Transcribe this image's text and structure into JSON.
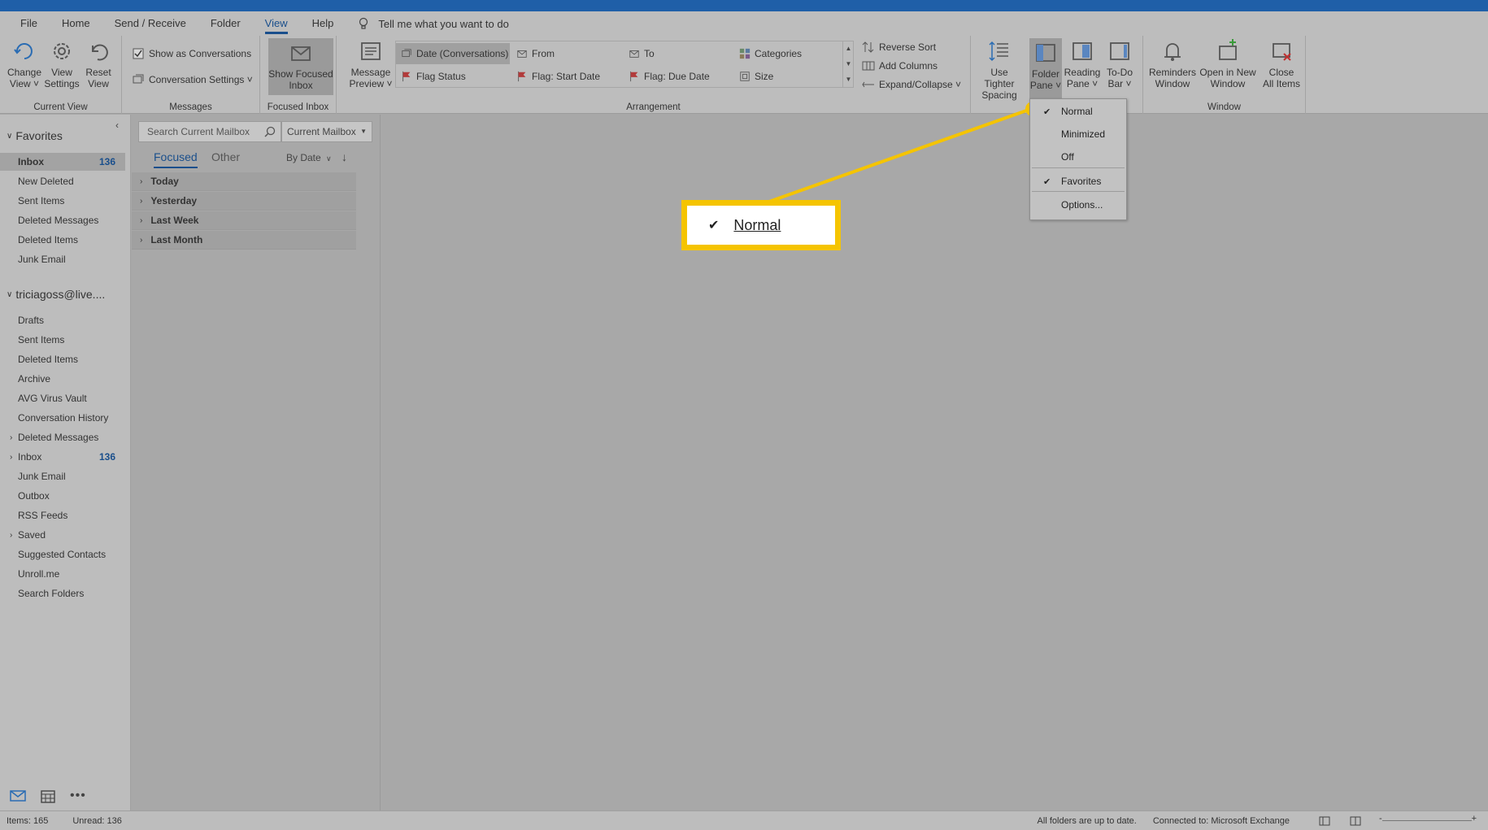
{
  "menu": {
    "tabs": [
      "File",
      "Home",
      "Send / Receive",
      "Folder",
      "View",
      "Help"
    ],
    "active_tab": "View",
    "tell_me": "Tell me what you want to do"
  },
  "ribbon": {
    "current_view": {
      "label": "Current View",
      "change_view": [
        "Change",
        "View ˅"
      ],
      "view_settings": [
        "View",
        "Settings"
      ],
      "reset_view": [
        "Reset",
        "View"
      ]
    },
    "messages": {
      "label": "Messages",
      "show_as_conversations": "Show as Conversations",
      "conversation_settings": "Conversation Settings ˅"
    },
    "focused_inbox": {
      "label": "Focused Inbox",
      "show_focused": [
        "Show Focused",
        "Inbox"
      ]
    },
    "arrangement": {
      "label": "Arrangement",
      "message_preview": [
        "Message",
        "Preview ˅"
      ],
      "items": [
        "Date (Conversations)",
        "From",
        "To",
        "Categories",
        "Flag Status",
        "Flag: Start Date",
        "Flag: Due Date",
        "Size"
      ],
      "reverse_sort": "Reverse Sort",
      "add_columns": "Add Columns",
      "expand_collapse": "Expand/Collapse ˅"
    },
    "layout": {
      "tighter_spacing": [
        "Use Tighter",
        "Spacing"
      ],
      "folder_pane": [
        "Folder",
        "Pane ˅"
      ],
      "reading_pane": [
        "Reading",
        "Pane ˅"
      ],
      "todo_bar": [
        "To-Do",
        "Bar ˅"
      ]
    },
    "window": {
      "label": "Window",
      "reminders": [
        "Reminders",
        "Window"
      ],
      "open_new": [
        "Open in New",
        "Window"
      ],
      "close_all": [
        "Close",
        "All Items"
      ]
    }
  },
  "nav": {
    "favorites_header": "Favorites",
    "favorites": [
      {
        "label": "Inbox",
        "count": "136"
      },
      {
        "label": "New Deleted",
        "count": ""
      },
      {
        "label": "Sent Items",
        "count": ""
      },
      {
        "label": "Deleted Messages",
        "count": ""
      },
      {
        "label": "Deleted Items",
        "count": ""
      },
      {
        "label": "Junk Email",
        "count": ""
      }
    ],
    "account_header": "triciagoss@live....",
    "account_folders": [
      {
        "label": "Drafts",
        "count": "",
        "expandable": false
      },
      {
        "label": "Sent Items",
        "count": "",
        "expandable": false
      },
      {
        "label": "Deleted Items",
        "count": "",
        "expandable": false
      },
      {
        "label": "Archive",
        "count": "",
        "expandable": false
      },
      {
        "label": "AVG Virus Vault",
        "count": "",
        "expandable": false
      },
      {
        "label": "Conversation History",
        "count": "",
        "expandable": false
      },
      {
        "label": "Deleted Messages",
        "count": "",
        "expandable": true
      },
      {
        "label": "Inbox",
        "count": "136",
        "expandable": true
      },
      {
        "label": "Junk Email",
        "count": "",
        "expandable": false
      },
      {
        "label": "Outbox",
        "count": "",
        "expandable": false
      },
      {
        "label": "RSS Feeds",
        "count": "",
        "expandable": false
      },
      {
        "label": "Saved",
        "count": "",
        "expandable": true
      },
      {
        "label": "Suggested Contacts",
        "count": "",
        "expandable": false
      },
      {
        "label": "Unroll.me",
        "count": "",
        "expandable": false
      },
      {
        "label": "Search Folders",
        "count": "",
        "expandable": false
      }
    ]
  },
  "list": {
    "search_placeholder": "Search Current Mailbox",
    "scope": "Current Mailbox",
    "tab_focused": "Focused",
    "tab_other": "Other",
    "sort": "By Date",
    "groups": [
      "Today",
      "Yesterday",
      "Last Week",
      "Last Month"
    ]
  },
  "dropdown": {
    "items": [
      {
        "label": "Normal",
        "checked": true
      },
      {
        "label": "Minimized",
        "checked": false
      },
      {
        "label": "Off",
        "checked": false
      },
      {
        "label": "Favorites",
        "checked": true
      },
      {
        "label": "Options...",
        "checked": false
      }
    ]
  },
  "callout": {
    "label": "Normal"
  },
  "status": {
    "items": "Items: 165",
    "unread": "Unread: 136",
    "sync": "All folders are up to date.",
    "connection": "Connected to: Microsoft Exchange"
  },
  "colors": {
    "accent": "#1a4f8c",
    "highlight": "#f5c400",
    "titlebar": "#1f5fa8"
  }
}
